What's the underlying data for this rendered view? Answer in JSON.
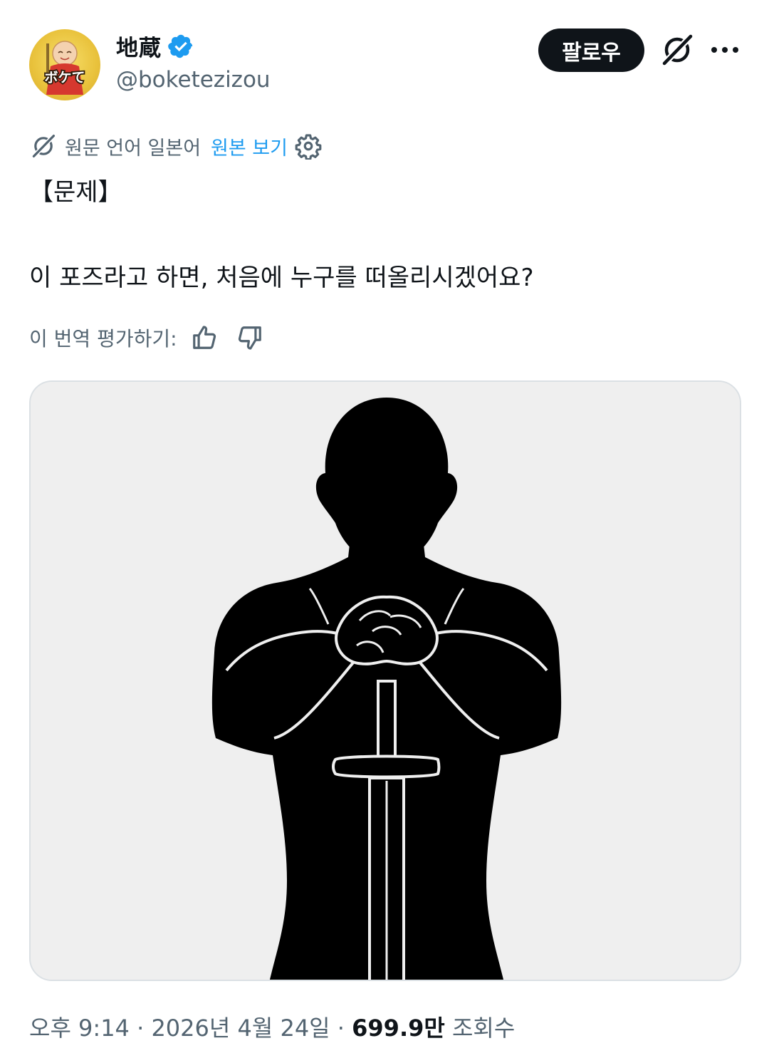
{
  "account": {
    "display_name": "地蔵",
    "handle": "@boketezizou",
    "verified": true,
    "avatar_text": "ボケて",
    "avatar_icon": "jizo-statue-avatar"
  },
  "actions": {
    "follow_label": "팔로우",
    "grok_icon": "grok-icon",
    "more_icon": "more-dots-icon"
  },
  "translation": {
    "source_language_label": "원문 언어 일본어",
    "show_original_label": "원본 보기",
    "settings_icon": "gear-icon",
    "rate_label": "이 번역 평가하기:"
  },
  "tweet": {
    "line1": "【문제】",
    "line2": "이 포즈라고 하면, 처음에 누구를 떠올리시겠어요?"
  },
  "media": {
    "description_icon": "silhouette-with-sword-image"
  },
  "meta": {
    "time": "오후 9:14",
    "separator": "·",
    "date": "2026년 4월 24일",
    "views_count": "699.9만",
    "views_label": "조회수"
  },
  "colors": {
    "text_primary": "#0f1419",
    "text_secondary": "#536471",
    "link": "#1d9bf0",
    "verified": "#1d9bf0",
    "follow_bg": "#0f1419",
    "media_bg": "#efefef"
  }
}
